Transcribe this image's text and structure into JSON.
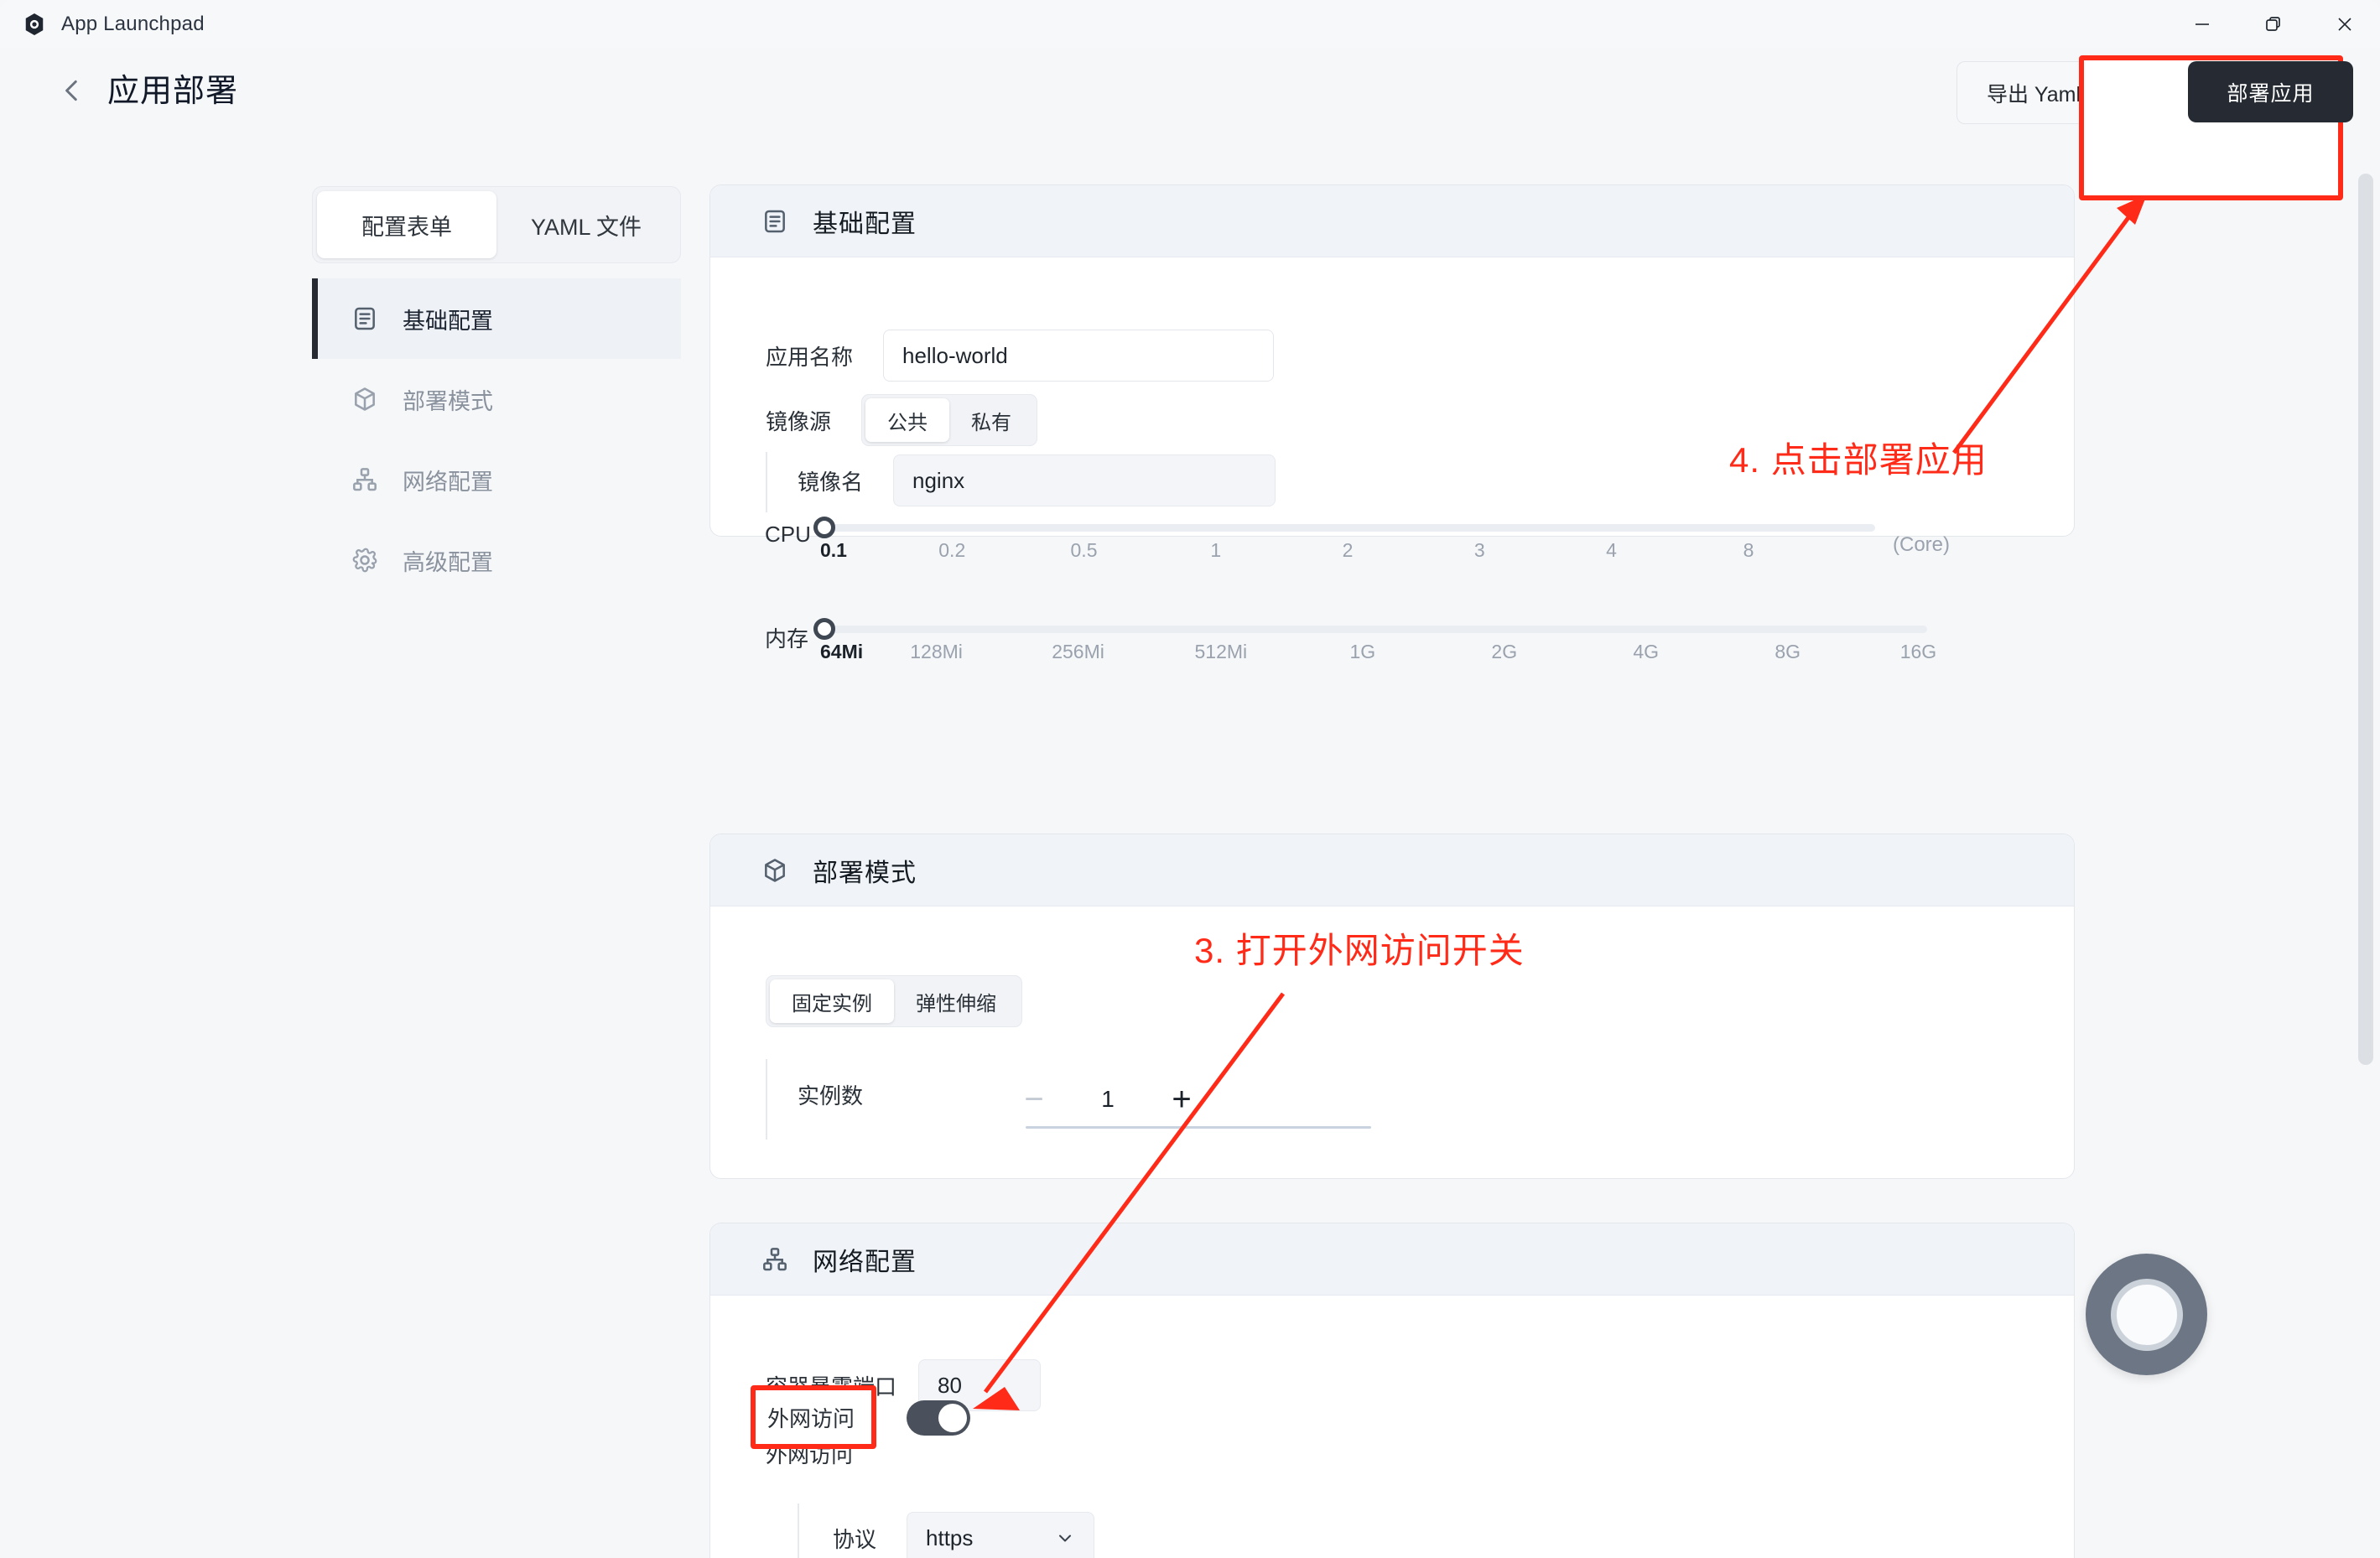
{
  "window": {
    "app_title": "App Launchpad",
    "logo_icon": "gem-icon",
    "controls": {
      "minimize": "minimize-icon",
      "maximize": "restore-icon",
      "close": "close-icon"
    }
  },
  "header": {
    "back_icon": "chevron-left-icon",
    "title": "应用部署",
    "export_label": "导出 Yaml",
    "deploy_label": "部署应用"
  },
  "leftnav": {
    "tabs": [
      {
        "label": "配置表单",
        "active": true
      },
      {
        "label": "YAML 文件",
        "active": false
      }
    ],
    "items": [
      {
        "label": "基础配置",
        "icon": "document-list-icon",
        "active": true
      },
      {
        "label": "部署模式",
        "icon": "cube-icon",
        "active": false
      },
      {
        "label": "网络配置",
        "icon": "sitemap-icon",
        "active": false
      },
      {
        "label": "高级配置",
        "icon": "gear-icon",
        "active": false
      }
    ]
  },
  "basic_config": {
    "title": "基础配置",
    "icon": "document-list-icon",
    "app_name_label": "应用名称",
    "app_name_value": "hello-world",
    "app_name_placeholder": "应用名称",
    "image_source_label": "镜像源",
    "image_source_options": [
      {
        "label": "公共",
        "active": true
      },
      {
        "label": "私有",
        "active": false
      }
    ],
    "image_name_label": "镜像名",
    "image_name_value": "nginx",
    "image_name_placeholder": "镜像名",
    "cpu": {
      "label": "CPU",
      "unit": "(Core)",
      "value": "0.1",
      "ticks": [
        "0.1",
        "0.2",
        "0.5",
        "1",
        "2",
        "3",
        "4",
        "8"
      ]
    },
    "memory": {
      "label": "内存",
      "value": "64Mi",
      "ticks": [
        "64Mi",
        "128Mi",
        "256Mi",
        "512Mi",
        "1G",
        "2G",
        "4G",
        "8G",
        "16G"
      ]
    }
  },
  "deploy_mode": {
    "title": "部署模式",
    "icon": "cube-icon",
    "modes": [
      {
        "label": "固定实例",
        "active": true
      },
      {
        "label": "弹性伸缩",
        "active": false
      }
    ],
    "replicas_label": "实例数",
    "replicas_value": "1",
    "decrement": "−",
    "increment": "+"
  },
  "network_config": {
    "title": "网络配置",
    "icon": "sitemap-icon",
    "port_label": "容器暴露端口",
    "port_value": "80",
    "public_access_label": "外网访问",
    "public_access_on": true,
    "protocol_label": "协议",
    "protocol_value": "https",
    "protocol_caret": "chevron-down-icon"
  },
  "annotations": [
    {
      "id": "step-4",
      "text": "4. 点击部署应用"
    },
    {
      "id": "step-3",
      "text": "3. 打开外网访问开关"
    }
  ],
  "colors": {
    "accent_red": "#ff2a17",
    "dark_button": "#262b33",
    "panel_head": "#f0f4f8",
    "page_bg": "#f6f7f9"
  }
}
